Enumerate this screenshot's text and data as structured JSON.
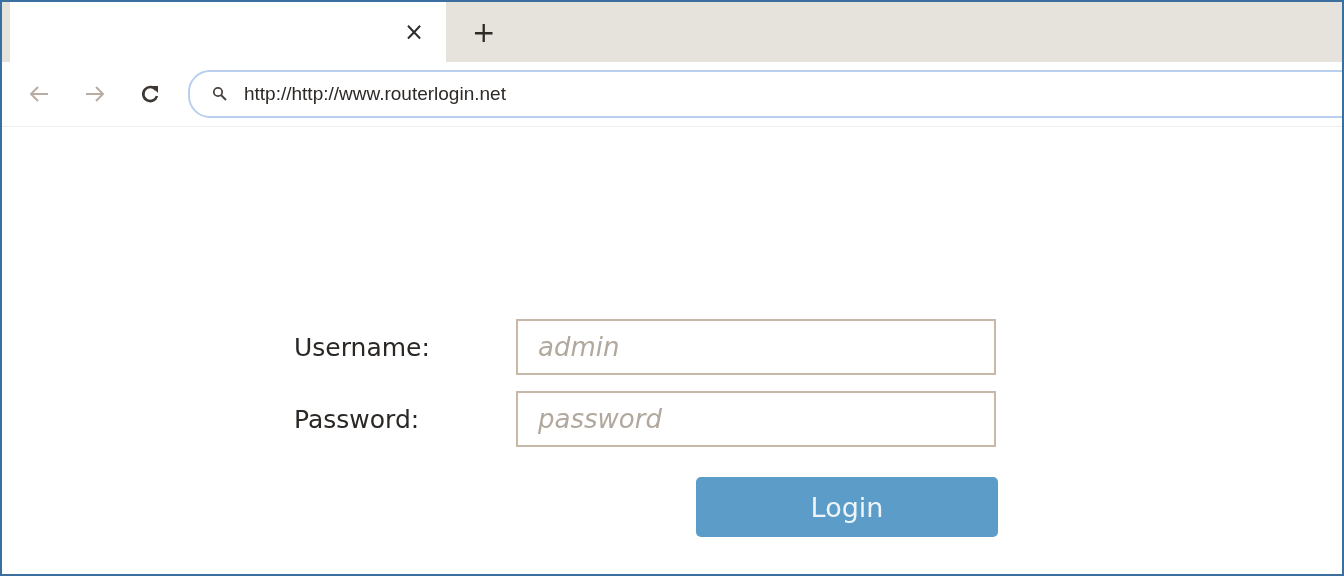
{
  "tab": {
    "close": "×",
    "new_tab": "+"
  },
  "address_bar": {
    "url": "http://http://www.routerlogin.net"
  },
  "login_form": {
    "fields": [
      {
        "label": "Username:",
        "placeholder": "admin"
      },
      {
        "label": "Password:",
        "placeholder": "password"
      }
    ],
    "button": "Login"
  }
}
